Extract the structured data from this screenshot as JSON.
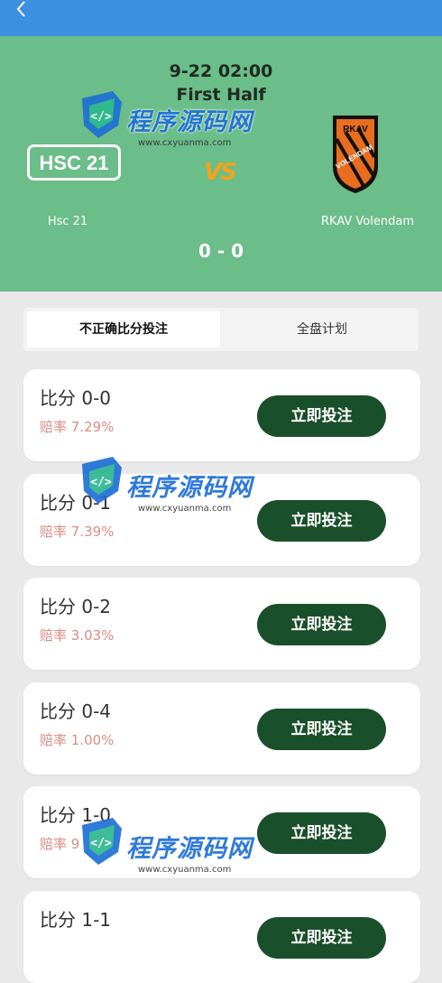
{
  "header": {
    "back_icon": "chevron-left-icon",
    "bar_color": "#3d8fe0"
  },
  "match": {
    "time": "9-22 02:00",
    "period": "First Half",
    "home_team": "Hsc 21",
    "away_team": "RKAV Volendam",
    "home_logo_text": "HSC 21",
    "away_logo_text_top": "RKAV",
    "away_logo_text_mid": "VOLENDAM",
    "vs_text": "VS",
    "score": "0 - 0",
    "hero_color": "#6bbd89"
  },
  "tabs": [
    {
      "label": "不正确比分投注",
      "active": true
    },
    {
      "label": "全盘计划",
      "active": false
    }
  ],
  "bets": [
    {
      "title": "比分 0-0",
      "odds": "赔率 7.29%",
      "button": "立即投注"
    },
    {
      "title": "比分 0-1",
      "odds": "赔率 7.39%",
      "button": "立即投注"
    },
    {
      "title": "比分 0-2",
      "odds": "赔率 3.03%",
      "button": "立即投注"
    },
    {
      "title": "比分 0-4",
      "odds": "赔率 1.00%",
      "button": "立即投注"
    },
    {
      "title": "比分 1-0",
      "odds": "赔率 9",
      "button": "立即投注"
    },
    {
      "title": "比分 1-1",
      "odds": "",
      "button": "立即投注"
    }
  ],
  "watermark": {
    "text": "程序源码网",
    "url": "www.cxyuanma.com"
  },
  "colors": {
    "button": "#1a4f2b",
    "odds": "#d98b86"
  }
}
